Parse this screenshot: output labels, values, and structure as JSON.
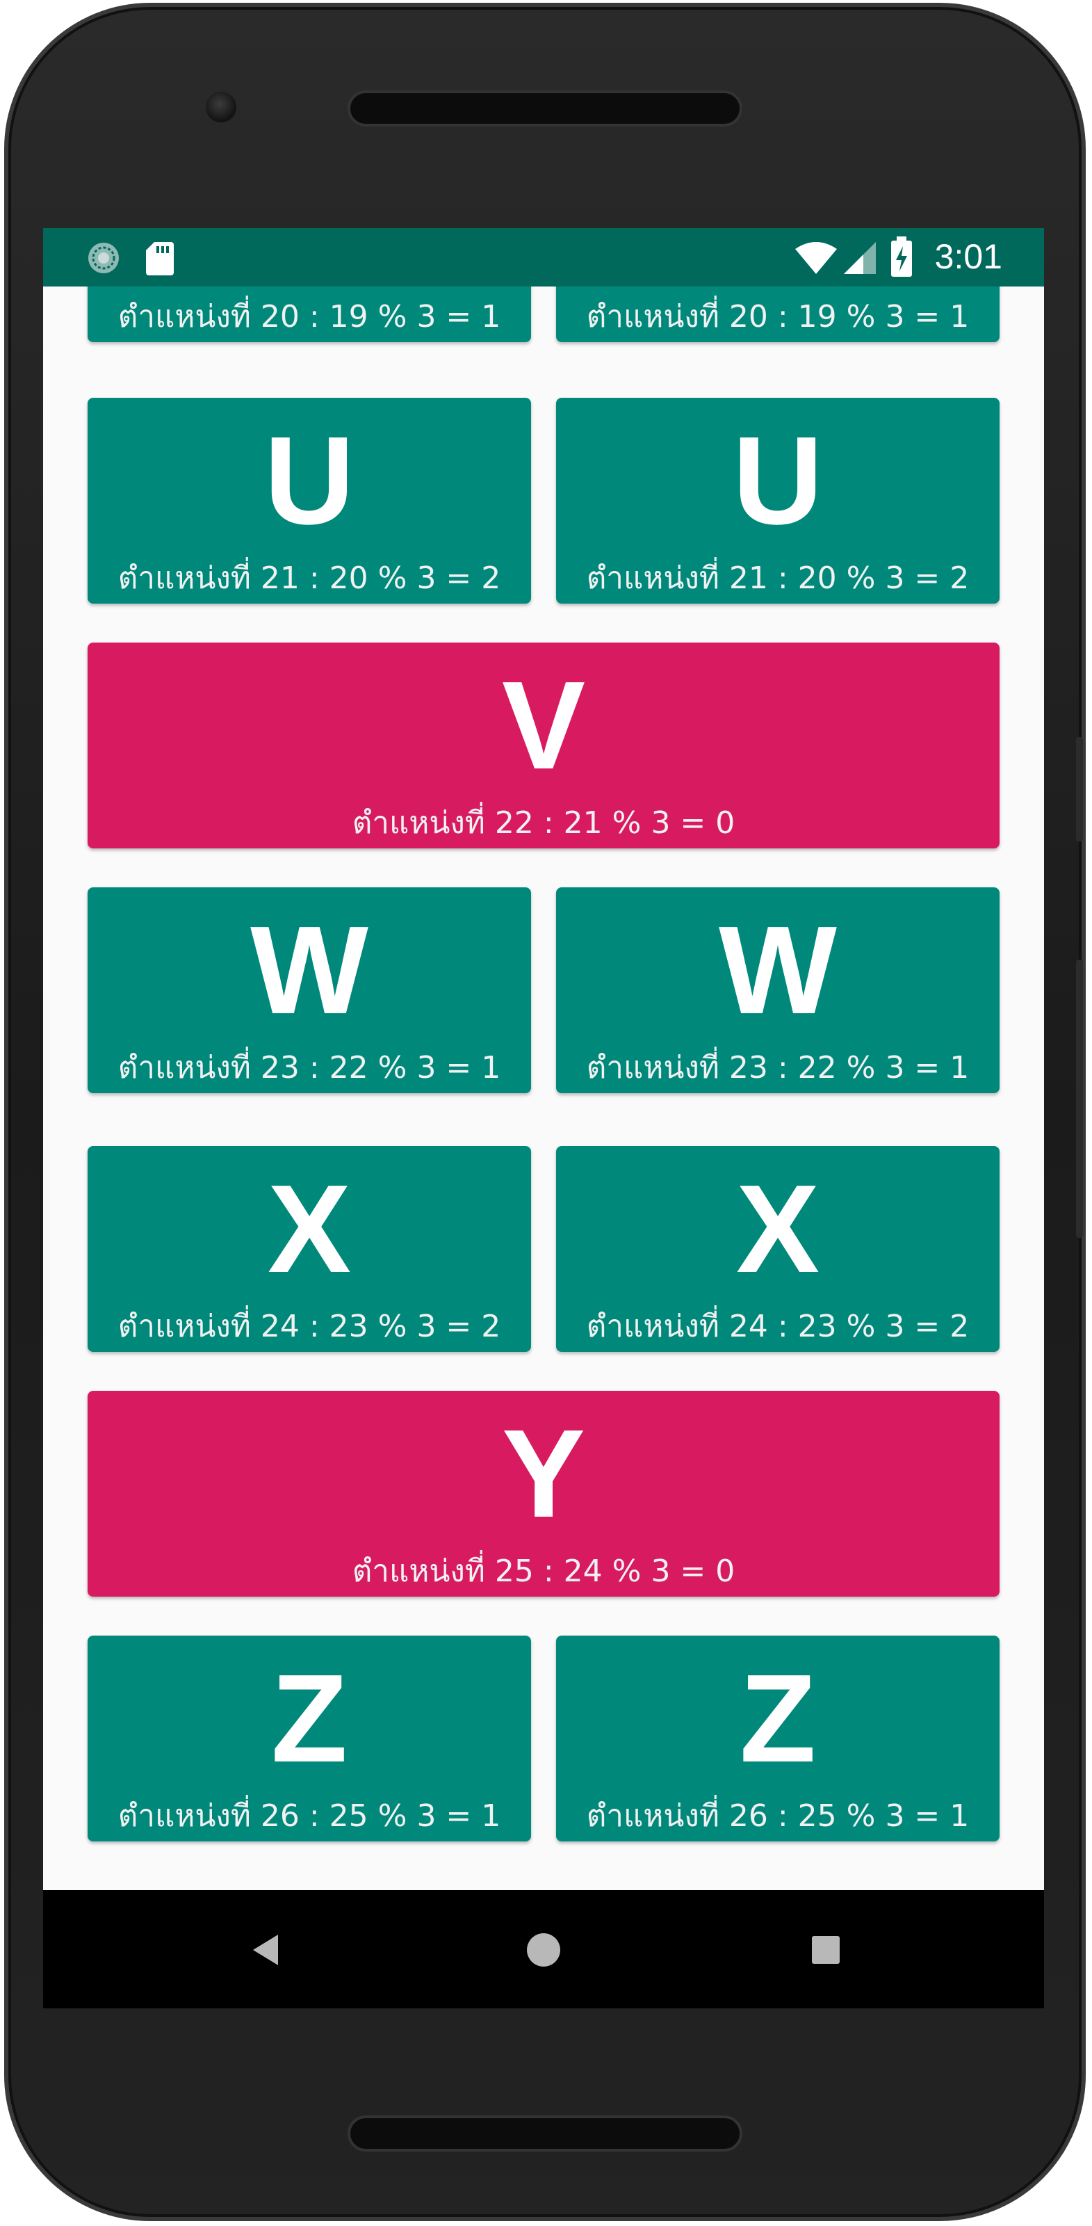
{
  "status_bar": {
    "time": "3:01",
    "icons": [
      "sync-icon",
      "sd-card-icon",
      "wifi-icon",
      "cellular-icon",
      "battery-charging-icon"
    ]
  },
  "colors": {
    "teal": "#00897b",
    "pink": "#d81b60",
    "status_bar": "#00695c"
  },
  "grid": {
    "items": [
      {
        "letter": "",
        "caption": "ตำแหน่งที่ 20 : 19 % 3 = 1",
        "color": "teal"
      },
      {
        "letter": "",
        "caption": "ตำแหน่งที่ 20 : 19 % 3 = 1",
        "color": "teal"
      },
      {
        "letter": "U",
        "caption": "ตำแหน่งที่ 21 : 20 % 3 = 2",
        "color": "teal"
      },
      {
        "letter": "U",
        "caption": "ตำแหน่งที่ 21 : 20 % 3 = 2",
        "color": "teal"
      },
      {
        "letter": "V",
        "caption": "ตำแหน่งที่ 22 : 21 % 3 = 0",
        "color": "pink"
      },
      {
        "letter": "W",
        "caption": "ตำแหน่งที่ 23 : 22 % 3 = 1",
        "color": "teal"
      },
      {
        "letter": "W",
        "caption": "ตำแหน่งที่ 23 : 22 % 3 = 1",
        "color": "teal"
      },
      {
        "letter": "X",
        "caption": "ตำแหน่งที่ 24 : 23 % 3 = 2",
        "color": "teal"
      },
      {
        "letter": "X",
        "caption": "ตำแหน่งที่ 24 : 23 % 3 = 2",
        "color": "teal"
      },
      {
        "letter": "Y",
        "caption": "ตำแหน่งที่ 25 : 24 % 3 = 0",
        "color": "pink"
      },
      {
        "letter": "Z",
        "caption": "ตำแหน่งที่ 26 : 25 % 3 = 1",
        "color": "teal"
      },
      {
        "letter": "Z",
        "caption": "ตำแหน่งที่ 26 : 25 % 3 = 1",
        "color": "teal"
      }
    ]
  },
  "nav_bar": {
    "buttons": [
      "back-icon",
      "home-icon",
      "recents-icon"
    ]
  }
}
